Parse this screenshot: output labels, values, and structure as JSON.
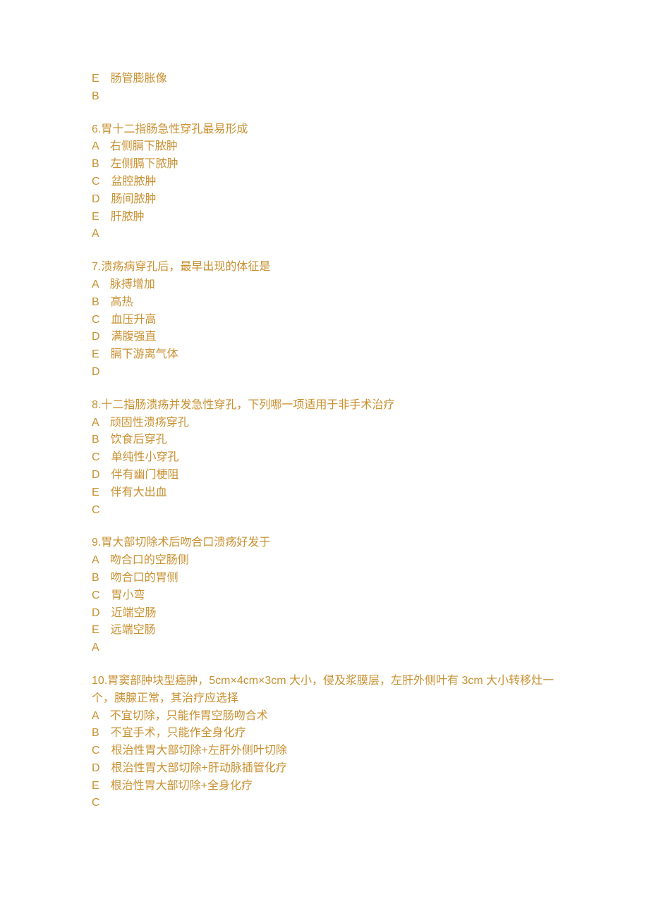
{
  "frag_before": {
    "option_e": "E　肠管膨胀像",
    "answer": "B"
  },
  "q6": {
    "stem": "6.胃十二指肠急性穿孔最易形成",
    "opts": {
      "A": "A　右侧膈下脓肿",
      "B": "B　左侧膈下脓肿",
      "C": "C　盆腔脓肿",
      "D": "D　肠间脓肿",
      "E": "E　肝脓肿"
    },
    "answer": "A"
  },
  "q7": {
    "stem": "7.溃疡病穿孔后，最早出现的体征是",
    "opts": {
      "A": "A　脉搏增加",
      "B": "B　高热",
      "C": "C　血压升高",
      "D": "D　满腹强直",
      "E": "E　膈下游离气体"
    },
    "answer": "D"
  },
  "q8": {
    "stem": "8.十二指肠溃疡并发急性穿孔，下列哪一项适用于非手术治疗",
    "opts": {
      "A": "A　顽固性溃疡穿孔",
      "B": "B　饮食后穿孔",
      "C": "C　单纯性小穿孔",
      "D": "D　伴有幽门梗阻",
      "E": "E　伴有大出血"
    },
    "answer": "C"
  },
  "q9": {
    "stem": "9.胃大部切除术后吻合口溃疡好发于",
    "opts": {
      "A": "A　吻合口的空肠侧",
      "B": "B　吻合口的胃侧",
      "C": "C　胃小弯",
      "D": "D　近端空肠",
      "E": "E　远端空肠"
    },
    "answer": "A"
  },
  "q10": {
    "stem": "10.胃窦部肿块型癌肿，5cm×4cm×3cm 大小，侵及浆膜层，左肝外侧叶有 3cm 大小转移灶一个，胰腺正常，其治疗应选择",
    "opts": {
      "A": "A　不宜切除，只能作胃空肠吻合术",
      "B": "B　不宜手术，只能作全身化疗",
      "C": "C　根治性胃大部切除+左肝外侧叶切除",
      "D": "D　根治性胃大部切除+肝动脉插管化疗",
      "E": "E　根治性胃大部切除+全身化疗"
    },
    "answer": "C"
  }
}
